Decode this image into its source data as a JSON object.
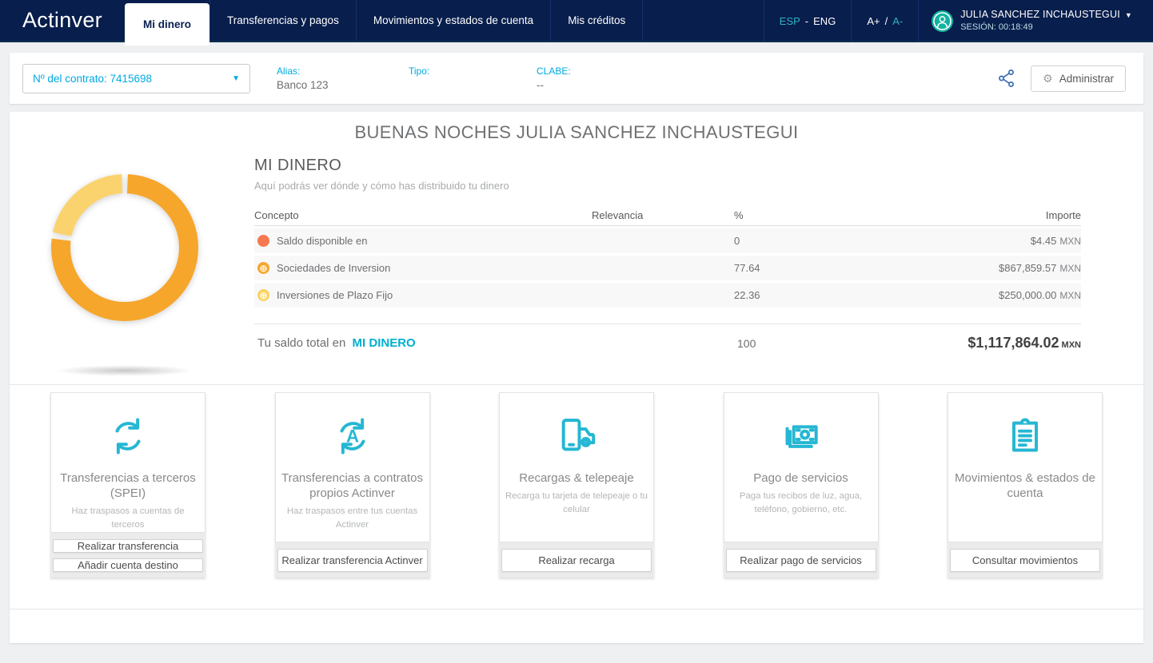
{
  "header": {
    "logo": "Actinver",
    "tabs": [
      {
        "label": "Mi dinero",
        "active": true
      },
      {
        "label": "Transferencias y pagos",
        "active": false
      },
      {
        "label": "Movimientos y estados de cuenta",
        "active": false
      },
      {
        "label": "Mis créditos",
        "active": false
      }
    ],
    "lang": {
      "primary": "ESP",
      "divider": "-",
      "secondary": "ENG"
    },
    "fontsize": {
      "plus": "A+",
      "divider": "/",
      "minus": "A-"
    },
    "user": {
      "name": "JULIA SANCHEZ INCHAUSTEGUI",
      "session": "SESIÓN: 00:18:49"
    }
  },
  "contract_bar": {
    "contract_select": "Nº del contrato: 7415698",
    "fields": [
      {
        "label": "Alias:",
        "value": "Banco 123"
      },
      {
        "label": "Tipo:",
        "value": ""
      },
      {
        "label": "CLABE:",
        "value": "--"
      }
    ],
    "administrar_label": "Administrar"
  },
  "main": {
    "greeting": "BUENAS NOCHES JULIA SANCHEZ INCHAUSTEGUI",
    "section_title": "MI DINERO",
    "section_subtitle": "Aquí podrás ver dónde y cómo has distribuido tu dinero",
    "table": {
      "headers": {
        "concepto": "Concepto",
        "relevancia": "Relevancia",
        "pct": "%",
        "importe": "Importe"
      },
      "rows": [
        {
          "icon": "dot",
          "color": "#f4794f",
          "concepto": "Saldo disponible en",
          "pct": 0,
          "pct_label": "0",
          "importe": "$4.45",
          "currency": "MXN"
        },
        {
          "icon": "coin",
          "color": "#f6a62b",
          "concepto": "Sociedades de Inversion",
          "pct": 77.64,
          "pct_label": "77.64",
          "importe": "$867,859.57",
          "currency": "MXN"
        },
        {
          "icon": "coin",
          "color": "#fbd35e",
          "concepto": "Inversiones de Plazo Fijo",
          "pct": 22.36,
          "pct_label": "22.36",
          "importe": "$250,000.00",
          "currency": "MXN"
        }
      ],
      "total": {
        "prefix": "Tu saldo total en",
        "link": "MI DINERO",
        "pct": "100",
        "amount": "$1,117,864.02",
        "currency": "MXN"
      }
    }
  },
  "chart_data": {
    "type": "pie",
    "donut": true,
    "categories": [
      "Sociedades de Inversion",
      "Inversiones de Plazo Fijo",
      "Saldo disponible en"
    ],
    "values": [
      77.64,
      22.36,
      0
    ],
    "colors": [
      "#f6a62b",
      "#fbd36e",
      "#f4794f"
    ],
    "legend_position": "none",
    "title": ""
  },
  "cards": [
    {
      "icon": "transfer-arrows-icon",
      "title": "Transferencias a terceros (SPEI)",
      "subtitle": "Haz traspasos a cuentas de terceros",
      "buttons": [
        "Realizar transferencia",
        "Añadir cuenta destino"
      ]
    },
    {
      "icon": "transfer-arrows-a-icon",
      "title": "Transferencias a contratos propios Actinver",
      "subtitle": "Haz traspasos entre tus cuentas Actinver",
      "buttons": [
        "Realizar transferencia Actinver"
      ]
    },
    {
      "icon": "phone-car-icon",
      "title": "Recargas & telepeaje",
      "subtitle": "Recarga tu tarjeta de telepeaje o tu celular",
      "buttons": [
        "Realizar recarga"
      ]
    },
    {
      "icon": "money-bills-icon",
      "title": "Pago de servicios",
      "subtitle": "Paga tus recibos de luz, agua, teléfono, gobierno, etc.",
      "buttons": [
        "Realizar pago de servicios"
      ]
    },
    {
      "icon": "clipboard-icon",
      "title": "Movimientos & estados de cuenta",
      "subtitle": "",
      "buttons": [
        "Consultar movimientos"
      ]
    }
  ],
  "colors": {
    "navy": "#081e4c",
    "cyan_link": "#00a9e0",
    "teal": "#2fb4c2",
    "avatar_teal": "#10b2a0",
    "icon_cyan": "#25b7d3",
    "orange": "#f6a62b",
    "yellow": "#fbd35e",
    "salmon": "#f4794f",
    "total_link": "#00b0cf"
  }
}
